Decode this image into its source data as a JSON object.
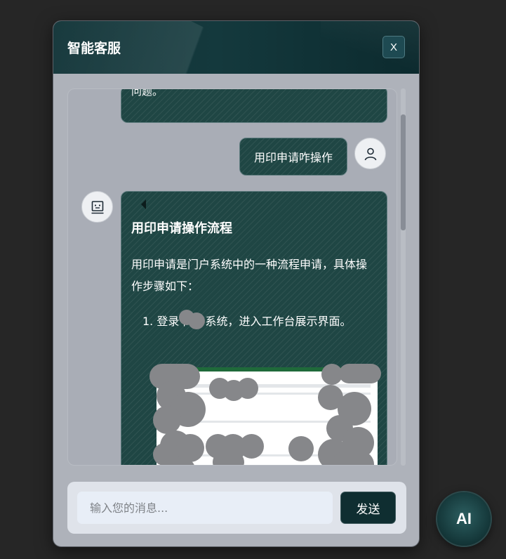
{
  "header": {
    "title": "智能客服",
    "close_label": "X"
  },
  "messages": [
    {
      "role": "bot",
      "text": "问题。"
    },
    {
      "role": "user",
      "text": "用印申请咋操作"
    },
    {
      "role": "bot",
      "heading": "用印申请操作流程",
      "intro": "用印申请是门户系统中的一种流程申请，具体操作步骤如下：",
      "steps": [
        "1. 登录    门户系统，进入工作台展示界面。"
      ]
    }
  ],
  "composer": {
    "placeholder": "输入您的消息...",
    "send_label": "发送"
  },
  "fab": {
    "label": "AI"
  },
  "icons": {
    "user_avatar": "user-icon",
    "bot_avatar": "robot-icon"
  },
  "colors": {
    "header_bg": "#0f3236",
    "bubble_bg": "#1f4644",
    "send_bg": "#0f2e31",
    "page_bg": "#262626"
  }
}
